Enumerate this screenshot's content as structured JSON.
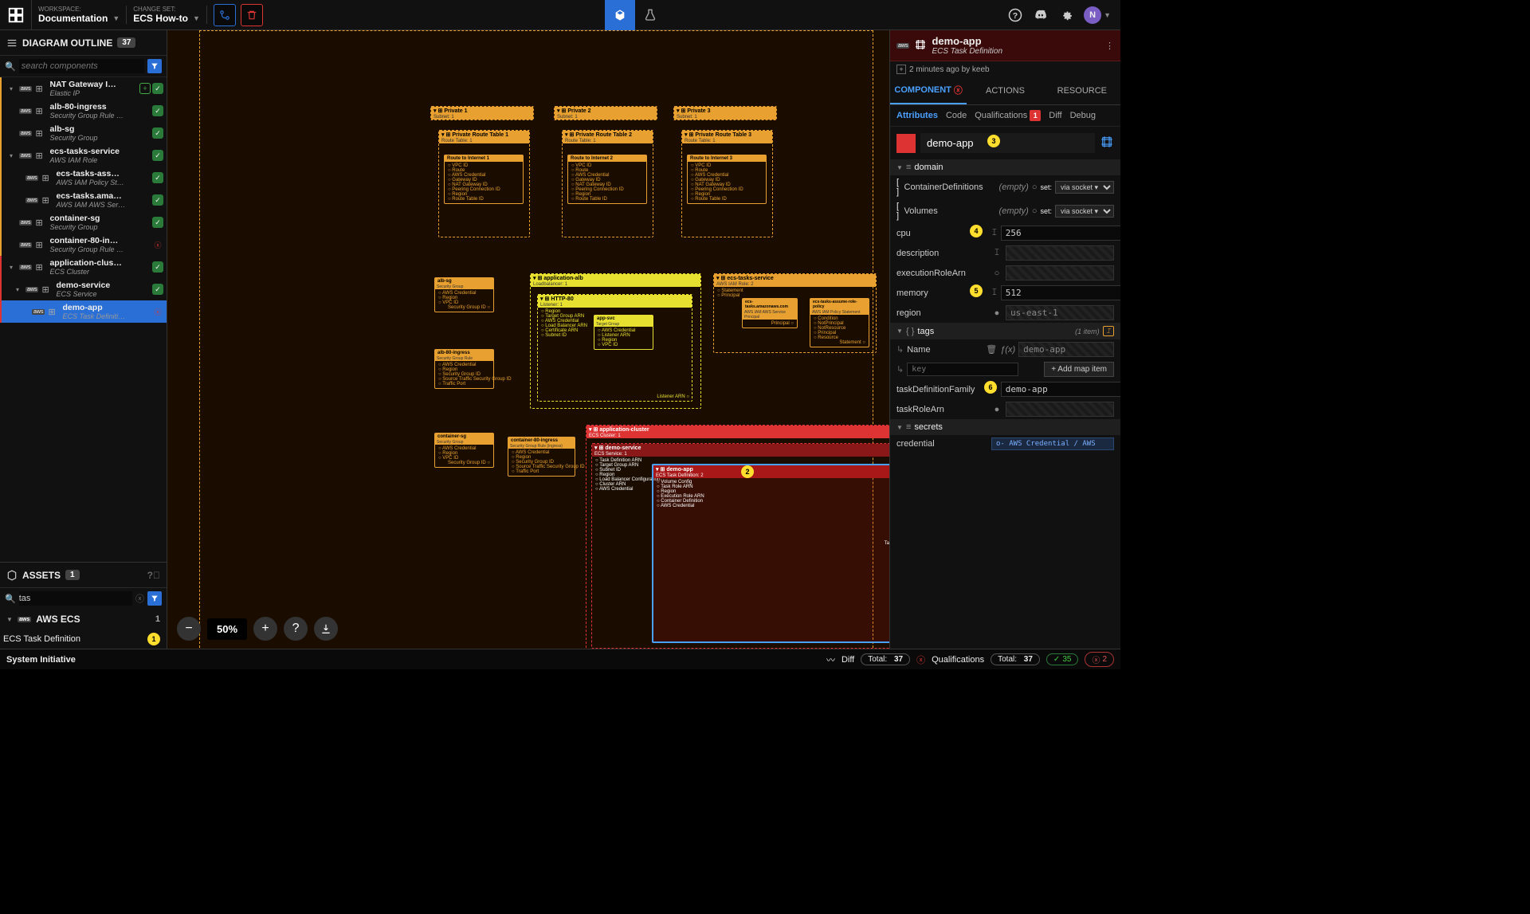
{
  "topbar": {
    "workspace_label": "WORKSPACE:",
    "workspace_value": "Documentation",
    "changeset_label": "CHANGE SET:",
    "changeset_value": "ECS How-to"
  },
  "avatar": "N",
  "outline": {
    "title": "DIAGRAM OUTLINE",
    "count": "37",
    "search_placeholder": "search components",
    "items": [
      {
        "name": "NAT Gateway I…",
        "sub": "Elastic IP",
        "status": [
          "diff",
          "ok"
        ],
        "color": "orange",
        "chev": true
      },
      {
        "name": "alb-80-ingress",
        "sub": "Security Group Rule …",
        "status": [
          "ok"
        ],
        "color": "orange"
      },
      {
        "name": "alb-sg",
        "sub": "Security Group",
        "status": [
          "ok"
        ],
        "color": "orange"
      },
      {
        "name": "ecs-tasks-service",
        "sub": "AWS IAM Role",
        "status": [
          "ok"
        ],
        "color": "orange",
        "chev": true
      },
      {
        "name": "ecs-tasks-ass…",
        "sub": "AWS IAM Policy St…",
        "status": [
          "ok"
        ],
        "color": "orange",
        "indent": true
      },
      {
        "name": "ecs-tasks.ama…",
        "sub": "AWS IAM AWS Ser…",
        "status": [
          "ok"
        ],
        "color": "orange",
        "indent": true
      },
      {
        "name": "container-sg",
        "sub": "Security Group",
        "status": [
          "ok"
        ],
        "color": "orange"
      },
      {
        "name": "container-80-in…",
        "sub": "Security Group Rule …",
        "status": [
          "err"
        ],
        "color": "orange"
      },
      {
        "name": "application-clus…",
        "sub": "ECS Cluster",
        "status": [
          "ok"
        ],
        "color": "red",
        "chev": true
      },
      {
        "name": "demo-service",
        "sub": "ECS Service",
        "status": [
          "ok"
        ],
        "color": "red",
        "chev": true,
        "indent": true
      },
      {
        "name": "demo-app",
        "sub": "ECS Task Definiti…",
        "status": [
          "err"
        ],
        "color": "red",
        "sel": true,
        "indent": true,
        "indent2": true
      }
    ]
  },
  "assets": {
    "title": "ASSETS",
    "count": "1",
    "search_value": "tas",
    "category": "AWS ECS",
    "category_count": "1",
    "item": "ECS Task Definition"
  },
  "zoom": "50%",
  "rpanel": {
    "provider": "aws",
    "title": "demo-app",
    "subtitle": "ECS Task Definition",
    "meta": "2 minutes ago by keeb",
    "tabs": [
      "COMPONENT",
      "ACTIONS",
      "RESOURCE"
    ],
    "subtabs": [
      "Attributes",
      "Code",
      "Qualifications",
      "Diff",
      "Debug"
    ],
    "qual_count": "1",
    "name_value": "demo-app",
    "domain": {
      "title": "domain",
      "containerdef": "ContainerDefinitions",
      "containerdef_hint": "(empty)",
      "volumes": "Volumes",
      "volumes_hint": "(empty)",
      "set_label": "set:",
      "socket_opt": "via socket ▾",
      "cpu_label": "cpu",
      "cpu_value": "256",
      "desc_label": "description",
      "exec_label": "executionRoleArn",
      "mem_label": "memory",
      "mem_value": "512",
      "region_label": "region",
      "region_value": "us-east-1"
    },
    "tags": {
      "title": "tags",
      "hint": "(1 item)",
      "name_label": "Name",
      "name_value": "demo-app",
      "key_placeholder": "key",
      "add_btn": "+ Add map item"
    },
    "tdf_label": "taskDefinitionFamily",
    "tdf_value": "demo-app",
    "tra_label": "taskRoleArn",
    "secrets": {
      "title": "secrets",
      "cred_label": "credential",
      "cred_value": "o- AWS Credential / AWS"
    }
  },
  "markers": {
    "m1": "1",
    "m2": "2",
    "m3": "3",
    "m4": "4",
    "m5": "5",
    "m6": "6"
  },
  "statusbar": {
    "brand": "System Initiative",
    "diff": "Diff",
    "diff_total_label": "Total:",
    "diff_total": "37",
    "qual": "Qualifications",
    "qual_total_label": "Total:",
    "qual_total": "37",
    "qual_ok": "35",
    "qual_err": "2"
  },
  "canvas": {
    "private1": "Private 1",
    "private1_sub": "Subnet: 1",
    "private2": "Private 2",
    "private2_sub": "Subnet: 1",
    "private3": "Private 3",
    "private3_sub": "Subnet: 1",
    "prt1": "Private Route Table 1",
    "prt1_sub": "Route Table: 1",
    "prt2": "Private Route Table 2",
    "prt2_sub": "Route Table: 1",
    "prt3": "Private Route Table 3",
    "prt3_sub": "Route Table: 1",
    "rti1": "Route to Internet 1",
    "rti_sub": "Route",
    "rti2": "Route to Internet 2",
    "rti3": "Route to Internet 3",
    "alb": "application-alb",
    "alb_sub": "Loadbalancer: 1",
    "http": "HTTP-80",
    "http_sub": "Listener: 1",
    "appsvc": "app-svc",
    "appsvc_sub": "Target Group",
    "albsg": "alb-sg",
    "albsg_sub": "Security Group",
    "albing": "alb-80-ingress",
    "albing_sub": "Security Group Rule",
    "csg": "container-sg",
    "csg_sub": "Security Group",
    "cing": "container-80-ingress",
    "cing_sub": "Security Group Rule (ingress)",
    "ets": "ecs-tasks-service",
    "ets_sub": "AWS IAM Role: 2",
    "eta": "ecs-tasks.amazonaws.com",
    "eta_sub": "AWS IAM AWS Service Principal",
    "etp": "ecs-tasks-assume-role-policy",
    "etp_sub": "AWS IAM Policy Statement",
    "appclus": "application-cluster",
    "appclus_sub": "ECS Cluster: 1",
    "demosvc": "demo-service",
    "demosvc_sub": "ECS Service: 1",
    "demoapp": "demo-app",
    "demoapp_sub": "ECS Task Definition: 2",
    "p_vpcid": "VPC ID",
    "p_route": "Route",
    "p_awscred": "AWS Credential",
    "p_gwid": "Gateway ID",
    "p_natgw": "NAT Gateway ID",
    "p_peer": "Peering Connection ID",
    "p_region": "Region",
    "p_rtid": "Route Table ID",
    "p_sgid": "Security Group ID",
    "p_tgarn": "Target Group ARN",
    "p_lbarn": "Load Balancer ARN",
    "p_cert": "Certificate ARN",
    "p_subnet": "Subnet ID",
    "p_listarn": "Listener ARN",
    "p_traffic": "Traffic Port",
    "p_stmt": "Statement",
    "p_principal": "Principal",
    "p_cond": "Condition",
    "p_notprin": "NotPrincipal",
    "p_notres": "NotResource",
    "p_res": "Resource",
    "p_tdarn": "Task Definition ARN",
    "p_clarn": "Cluster ARN",
    "p_lbconf": "Load Balancer Configuration",
    "p_volcfg": "Volume Config",
    "p_trarn": "Task Role ARN",
    "p_erarn": "Execution Role ARN",
    "p_cdef": "Container Definition",
    "p_srctraf": "Source Traffic Security Group ID",
    "p_stgid": "Source Traffic Security Group ID"
  }
}
